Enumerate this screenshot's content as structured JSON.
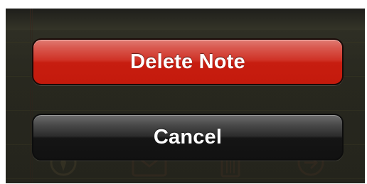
{
  "action_sheet": {
    "delete_label": "Delete Note",
    "cancel_label": "Cancel"
  },
  "toolbar": {
    "icons": [
      "compass-icon",
      "mail-icon",
      "trash-icon",
      "forward-arrow-icon"
    ]
  },
  "colors": {
    "destructive": "#c71d10",
    "cancel": "#2b2b2b",
    "background": "#2f2f24"
  }
}
